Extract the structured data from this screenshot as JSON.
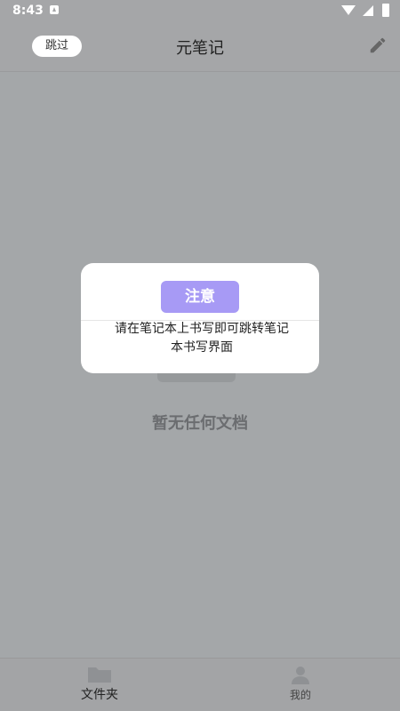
{
  "status_bar": {
    "time": "8:43",
    "icons": [
      "notification-a-icon",
      "wifi-icon",
      "signal-icon",
      "battery-icon"
    ]
  },
  "app_bar": {
    "skip_label": "跳过",
    "title": "元笔记",
    "edit_icon": "pencil-icon"
  },
  "main": {
    "empty_text": "暂无任何文档"
  },
  "dialog": {
    "title": "注意",
    "message": "请在笔记本上书写即可跳转笔记本书写界面",
    "title_bg": "#a79af5"
  },
  "bottom_nav": {
    "items": [
      {
        "label": "文件夹",
        "icon": "folder-icon"
      },
      {
        "label": "我的",
        "icon": "person-icon"
      }
    ]
  },
  "colors": {
    "overlay_bg": "#a4a7a9",
    "accent": "#a79af5"
  }
}
